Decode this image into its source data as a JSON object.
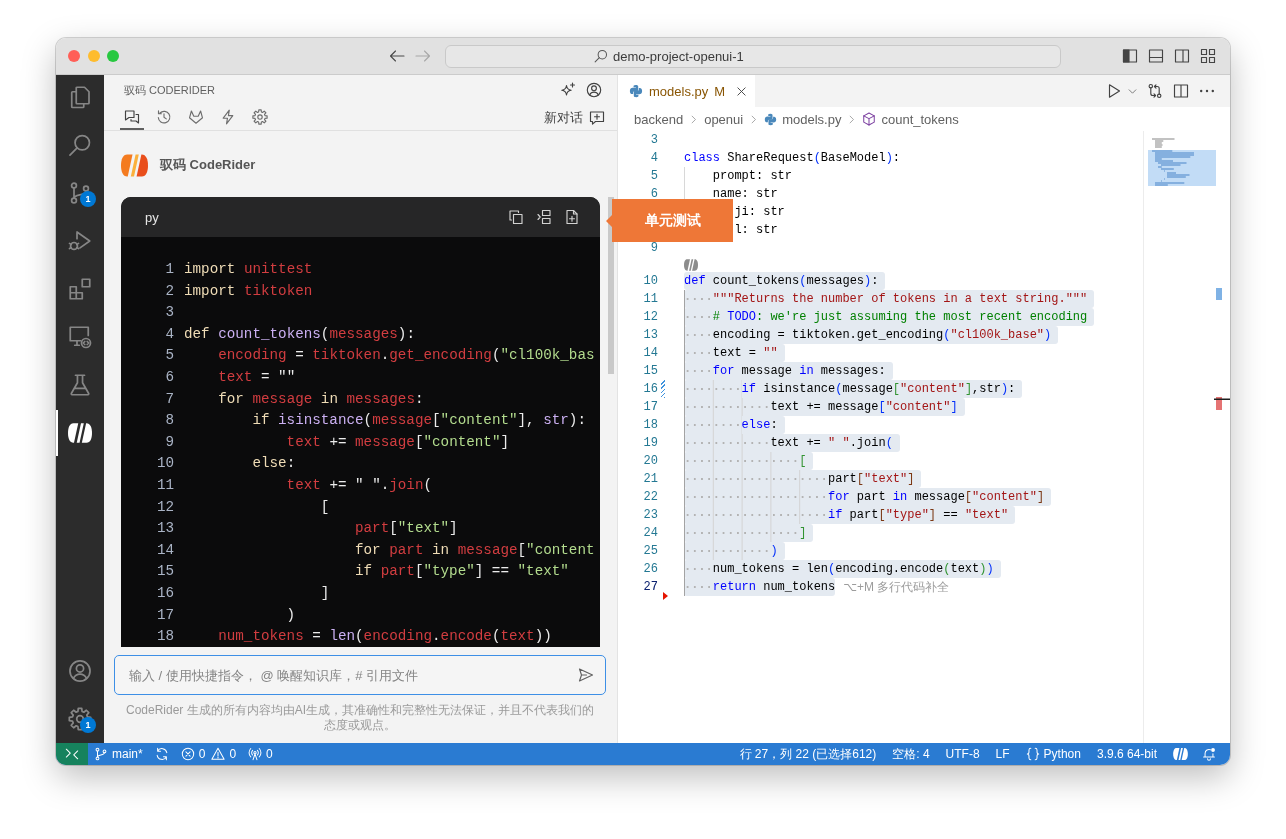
{
  "window": {
    "title": "demo-project-openui-1"
  },
  "activity_bar": {
    "items": [
      {
        "kind": "explorer",
        "selected": false
      },
      {
        "kind": "search",
        "selected": false
      },
      {
        "kind": "scm",
        "selected": false,
        "badge": "1"
      },
      {
        "kind": "debug",
        "selected": false
      },
      {
        "kind": "extensions",
        "selected": false
      },
      {
        "kind": "remote",
        "selected": false
      },
      {
        "kind": "testing",
        "selected": false
      },
      {
        "kind": "coderider",
        "selected": true
      }
    ],
    "bottom": [
      {
        "kind": "account"
      },
      {
        "kind": "manage",
        "badge": "1"
      }
    ]
  },
  "sidebar": {
    "title": "驭码 CODERIDER",
    "tabs": [
      {
        "kind": "chat",
        "selected": true
      },
      {
        "kind": "history",
        "selected": false
      },
      {
        "kind": "fox",
        "selected": false
      },
      {
        "kind": "lightning",
        "selected": false
      },
      {
        "kind": "settings",
        "selected": false
      }
    ],
    "new_chat": "新对话",
    "assistant": "驭码 CodeRider",
    "code_block": {
      "language": "py",
      "lines": [
        {
          "number": "1",
          "tokens": [
            {
              "kind": "keyword",
              "text": "import "
            },
            {
              "kind": "name",
              "text": "unittest"
            }
          ]
        },
        {
          "number": "2",
          "tokens": [
            {
              "kind": "keyword",
              "text": "import "
            },
            {
              "kind": "name",
              "text": "tiktoken"
            }
          ]
        },
        {
          "number": "3"
        },
        {
          "number": "4",
          "tokens": [
            {
              "kind": "keyword",
              "text": "def "
            },
            {
              "kind": "function",
              "text": "count_tokens"
            },
            {
              "kind": "text",
              "text": "("
            },
            {
              "kind": "name",
              "text": "messages"
            },
            {
              "kind": "text",
              "text": "):"
            }
          ],
          "children": [
            {
              "number": "5",
              "tokens": [
                {
                  "kind": "name",
                  "text": "encoding"
                },
                {
                  "kind": "text",
                  "text": " = "
                },
                {
                  "kind": "name",
                  "text": "tiktoken"
                },
                {
                  "kind": "text",
                  "text": "."
                },
                {
                  "kind": "name",
                  "text": "get_encoding"
                },
                {
                  "kind": "text",
                  "text": "("
                },
                {
                  "kind": "string",
                  "text": "\"cl100k_bas"
                }
              ]
            },
            {
              "number": "6",
              "tokens": [
                {
                  "kind": "name",
                  "text": "text"
                },
                {
                  "kind": "text",
                  "text": " = \"\""
                }
              ]
            },
            {
              "number": "7",
              "tokens": [
                {
                  "kind": "keyword",
                  "text": "for "
                },
                {
                  "kind": "name",
                  "text": "message"
                },
                {
                  "kind": "keyword",
                  "text": " in "
                },
                {
                  "kind": "name",
                  "text": "messages"
                },
                {
                  "kind": "text",
                  "text": ":"
                }
              ],
              "children": [
                {
                  "number": "8",
                  "tokens": [
                    {
                      "kind": "keyword",
                      "text": "if "
                    },
                    {
                      "kind": "function",
                      "text": "isinstance"
                    },
                    {
                      "kind": "text",
                      "text": "("
                    },
                    {
                      "kind": "name",
                      "text": "message"
                    },
                    {
                      "kind": "text",
                      "text": "["
                    },
                    {
                      "kind": "string",
                      "text": "\"content\""
                    },
                    {
                      "kind": "text",
                      "text": "], "
                    },
                    {
                      "kind": "function",
                      "text": "str"
                    },
                    {
                      "kind": "text",
                      "text": "):"
                    }
                  ],
                  "children": [
                    {
                      "number": "9",
                      "tokens": [
                        {
                          "kind": "name",
                          "text": "text"
                        },
                        {
                          "kind": "text",
                          "text": " += "
                        },
                        {
                          "kind": "name",
                          "text": "message"
                        },
                        {
                          "kind": "text",
                          "text": "["
                        },
                        {
                          "kind": "string",
                          "text": "\"content\""
                        },
                        {
                          "kind": "text",
                          "text": "]"
                        }
                      ]
                    }
                  ]
                },
                {
                  "number": "10",
                  "tokens": [
                    {
                      "kind": "keyword",
                      "text": "else"
                    },
                    {
                      "kind": "text",
                      "text": ":"
                    }
                  ],
                  "children": [
                    {
                      "number": "11",
                      "tokens": [
                        {
                          "kind": "name",
                          "text": "text"
                        },
                        {
                          "kind": "text",
                          "text": " += \" \"."
                        },
                        {
                          "kind": "name",
                          "text": "join"
                        },
                        {
                          "kind": "text",
                          "text": "("
                        }
                      ],
                      "children": [
                        {
                          "number": "12",
                          "tokens": [
                            {
                              "kind": "text",
                              "text": "["
                            }
                          ],
                          "children": [
                            {
                              "number": "13",
                              "tokens": [
                                {
                                  "kind": "name",
                                  "text": "part"
                                },
                                {
                                  "kind": "text",
                                  "text": "["
                                },
                                {
                                  "kind": "string",
                                  "text": "\"text\""
                                },
                                {
                                  "kind": "text",
                                  "text": "]"
                                }
                              ]
                            },
                            {
                              "number": "14",
                              "tokens": [
                                {
                                  "kind": "keyword",
                                  "text": "for "
                                },
                                {
                                  "kind": "name",
                                  "text": "part"
                                },
                                {
                                  "kind": "keyword",
                                  "text": " in "
                                },
                                {
                                  "kind": "name",
                                  "text": "message"
                                },
                                {
                                  "kind": "text",
                                  "text": "["
                                },
                                {
                                  "kind": "string",
                                  "text": "\"content"
                                }
                              ]
                            },
                            {
                              "number": "15",
                              "tokens": [
                                {
                                  "kind": "keyword",
                                  "text": "if "
                                },
                                {
                                  "kind": "name",
                                  "text": "part"
                                },
                                {
                                  "kind": "text",
                                  "text": "["
                                },
                                {
                                  "kind": "string",
                                  "text": "\"type\""
                                },
                                {
                                  "kind": "text",
                                  "text": "] == "
                                },
                                {
                                  "kind": "string",
                                  "text": "\"text\""
                                }
                              ]
                            }
                          ]
                        },
                        {
                          "number": "16",
                          "tokens": [
                            {
                              "kind": "text",
                              "text": "]"
                            }
                          ]
                        }
                      ]
                    },
                    {
                      "number": "17",
                      "tokens": [
                        {
                          "kind": "text",
                          "text": ")"
                        }
                      ]
                    }
                  ]
                }
              ]
            },
            {
              "number": "18",
              "tokens": [
                {
                  "kind": "name",
                  "text": "num_tokens"
                },
                {
                  "kind": "text",
                  "text": " = "
                },
                {
                  "kind": "function",
                  "text": "len"
                },
                {
                  "kind": "text",
                  "text": "("
                },
                {
                  "kind": "name",
                  "text": "encoding"
                },
                {
                  "kind": "text",
                  "text": "."
                },
                {
                  "kind": "name",
                  "text": "encode"
                },
                {
                  "kind": "text",
                  "text": "("
                },
                {
                  "kind": "name",
                  "text": "text"
                },
                {
                  "kind": "text",
                  "text": "))"
                }
              ]
            }
          ]
        }
      ]
    },
    "tooltip": "单元测试",
    "input": {
      "placeholder": "输入 / 使用快捷指令， @ 唤醒知识库，# 引用文件"
    },
    "disclaimer": "CodeRider 生成的所有内容均由AI生成，其准确性和完整性无法保证，并且不代表我们的态度或观点。"
  },
  "editor": {
    "tabs": [
      {
        "title": "models.py",
        "status": "M",
        "selected": true
      }
    ],
    "breadcrumbs": [
      {
        "kind": "folder",
        "text": "backend"
      },
      {
        "kind": "folder",
        "text": "openui"
      },
      {
        "kind": "file",
        "text": "models.py"
      },
      {
        "kind": "symbol",
        "text": "count_tokens"
      }
    ],
    "lines": [
      {
        "kind": "code",
        "number": "3",
        "selected": false,
        "current": false
      },
      {
        "kind": "code",
        "number": "4",
        "selected": false,
        "current": false,
        "tokens": [
          {
            "kind": "keyword",
            "text": "class"
          },
          {
            "kind": "text",
            "text": " ShareRequest"
          },
          {
            "kind": "bracket1",
            "text": "("
          },
          {
            "kind": "text",
            "text": "BaseModel"
          },
          {
            "kind": "bracket1",
            "text": ")"
          },
          {
            "kind": "text",
            "text": ":"
          }
        ],
        "children": [
          {
            "kind": "code",
            "number": "5",
            "selected": false,
            "current": false,
            "tokens": [
              {
                "kind": "text",
                "text": "prompt: str"
              }
            ]
          },
          {
            "kind": "code",
            "number": "6",
            "selected": false,
            "current": false,
            "tokens": [
              {
                "kind": "text",
                "text": "name: str"
              }
            ]
          },
          {
            "kind": "code",
            "selected": false,
            "tokens": [
              {
                "kind": "text",
                "text": "   ji: str"
              }
            ]
          },
          {
            "kind": "code",
            "selected": false,
            "tokens": [
              {
                "kind": "text",
                "text": "   l: str"
              }
            ]
          }
        ]
      },
      {
        "kind": "code",
        "number": "9",
        "selected": false,
        "current": false
      },
      {
        "kind": "codelens"
      },
      {
        "kind": "code",
        "number": "10",
        "selected": true,
        "current": false,
        "tokens": [
          {
            "kind": "keyword",
            "text": "def"
          },
          {
            "kind": "text",
            "text": " count_tokens"
          },
          {
            "kind": "bracket1",
            "text": "("
          },
          {
            "kind": "text",
            "text": "messages"
          },
          {
            "kind": "bracket1",
            "text": ")"
          },
          {
            "kind": "text",
            "text": ":"
          }
        ],
        "children": [
          {
            "kind": "code",
            "number": "11",
            "selected": true,
            "current": false,
            "tokens": [
              {
                "kind": "string",
                "text": "\"\"\"Returns the number of tokens in a text string.\"\"\""
              }
            ]
          },
          {
            "kind": "code",
            "number": "12",
            "selected": true,
            "current": false,
            "tokens": [
              {
                "kind": "comment",
                "text": "# "
              },
              {
                "kind": "tag",
                "text": "TODO"
              },
              {
                "kind": "comment",
                "text": ": we're just assuming the most recent encoding"
              }
            ]
          },
          {
            "kind": "code",
            "number": "13",
            "selected": true,
            "current": false,
            "tokens": [
              {
                "kind": "text",
                "text": "encoding = tiktoken.get_encoding"
              },
              {
                "kind": "bracket1",
                "text": "("
              },
              {
                "kind": "string",
                "text": "\"cl100k_base\""
              },
              {
                "kind": "bracket1",
                "text": ")"
              }
            ]
          },
          {
            "kind": "code",
            "number": "14",
            "selected": true,
            "current": false,
            "tokens": [
              {
                "kind": "text",
                "text": "text = "
              },
              {
                "kind": "string",
                "text": "\"\""
              }
            ]
          },
          {
            "kind": "code",
            "number": "15",
            "selected": true,
            "current": false,
            "tokens": [
              {
                "kind": "keyword",
                "text": "for"
              },
              {
                "kind": "text",
                "text": " message "
              },
              {
                "kind": "keyword",
                "text": "in"
              },
              {
                "kind": "text",
                "text": " messages:"
              }
            ],
            "children": [
              {
                "kind": "code",
                "number": "16",
                "selected": true,
                "current": false,
                "marker": {
                  "kind": "modified"
                },
                "tokens": [
                  {
                    "kind": "keyword",
                    "text": "if"
                  },
                  {
                    "kind": "text",
                    "text": " isinstance"
                  },
                  {
                    "kind": "bracket1",
                    "text": "("
                  },
                  {
                    "kind": "text",
                    "text": "message"
                  },
                  {
                    "kind": "bracket2",
                    "text": "["
                  },
                  {
                    "kind": "string",
                    "text": "\"content\""
                  },
                  {
                    "kind": "bracket2",
                    "text": "]"
                  },
                  {
                    "kind": "text",
                    "text": ",str"
                  },
                  {
                    "kind": "bracket1",
                    "text": ")"
                  },
                  {
                    "kind": "text",
                    "text": ":"
                  }
                ],
                "children": [
                  {
                    "kind": "code",
                    "number": "17",
                    "selected": true,
                    "current": false,
                    "tokens": [
                      {
                        "kind": "text",
                        "text": "text += message"
                      },
                      {
                        "kind": "bracket1",
                        "text": "["
                      },
                      {
                        "kind": "string",
                        "text": "\"content\""
                      },
                      {
                        "kind": "bracket1",
                        "text": "]"
                      }
                    ]
                  }
                ]
              },
              {
                "kind": "code",
                "number": "18",
                "selected": true,
                "current": false,
                "tokens": [
                  {
                    "kind": "keyword",
                    "text": "else"
                  },
                  {
                    "kind": "text",
                    "text": ":"
                  }
                ],
                "children": [
                  {
                    "kind": "code",
                    "number": "19",
                    "selected": true,
                    "current": false,
                    "tokens": [
                      {
                        "kind": "text",
                        "text": "text += "
                      },
                      {
                        "kind": "string",
                        "text": "\" \""
                      },
                      {
                        "kind": "text",
                        "text": ".join"
                      },
                      {
                        "kind": "bracket1",
                        "text": "("
                      }
                    ],
                    "children": [
                      {
                        "kind": "code",
                        "number": "20",
                        "selected": true,
                        "current": false,
                        "tokens": [
                          {
                            "kind": "bracket2",
                            "text": "["
                          }
                        ],
                        "children": [
                          {
                            "kind": "code",
                            "number": "21",
                            "selected": true,
                            "current": false,
                            "tokens": [
                              {
                                "kind": "text",
                                "text": "part"
                              },
                              {
                                "kind": "bracket3",
                                "text": "["
                              },
                              {
                                "kind": "string",
                                "text": "\"text\""
                              },
                              {
                                "kind": "bracket3",
                                "text": "]"
                              }
                            ]
                          },
                          {
                            "kind": "code",
                            "number": "22",
                            "selected": true,
                            "current": false,
                            "tokens": [
                              {
                                "kind": "keyword",
                                "text": "for"
                              },
                              {
                                "kind": "text",
                                "text": " part "
                              },
                              {
                                "kind": "keyword",
                                "text": "in"
                              },
                              {
                                "kind": "text",
                                "text": " message"
                              },
                              {
                                "kind": "bracket3",
                                "text": "["
                              },
                              {
                                "kind": "string",
                                "text": "\"content\""
                              },
                              {
                                "kind": "bracket3",
                                "text": "]"
                              }
                            ]
                          },
                          {
                            "kind": "code",
                            "number": "23",
                            "selected": true,
                            "current": false,
                            "tokens": [
                              {
                                "kind": "keyword",
                                "text": "if"
                              },
                              {
                                "kind": "text",
                                "text": " part"
                              },
                              {
                                "kind": "bracket3",
                                "text": "["
                              },
                              {
                                "kind": "string",
                                "text": "\"type\""
                              },
                              {
                                "kind": "bracket3",
                                "text": "]"
                              },
                              {
                                "kind": "text",
                                "text": " == "
                              },
                              {
                                "kind": "string",
                                "text": "\"text\""
                              }
                            ]
                          }
                        ]
                      },
                      {
                        "kind": "code",
                        "number": "24",
                        "selected": true,
                        "current": false,
                        "tokens": [
                          {
                            "kind": "bracket2",
                            "text": "]"
                          }
                        ]
                      }
                    ]
                  },
                  {
                    "kind": "code",
                    "number": "25",
                    "selected": true,
                    "current": false,
                    "tokens": [
                      {
                        "kind": "bracket1",
                        "text": ")"
                      }
                    ]
                  }
                ]
              }
            ]
          },
          {
            "kind": "code",
            "number": "26",
            "selected": true,
            "current": false,
            "tokens": [
              {
                "kind": "text",
                "text": "num_tokens = len"
              },
              {
                "kind": "bracket1",
                "text": "("
              },
              {
                "kind": "text",
                "text": "encoding.encode"
              },
              {
                "kind": "bracket2",
                "text": "("
              },
              {
                "kind": "text",
                "text": "text"
              },
              {
                "kind": "bracket2",
                "text": ")"
              },
              {
                "kind": "bracket1",
                "text": ")"
              }
            ]
          },
          {
            "kind": "code",
            "number": "27",
            "selected": true,
            "current": true,
            "marker": {
              "kind": "deleted"
            },
            "hint": "⌥+M 多行代码补全",
            "tokens": [
              {
                "kind": "keyword",
                "text": "return"
              },
              {
                "kind": "text",
                "text": " num_tokens"
              }
            ]
          }
        ]
      }
    ]
  },
  "status_bar": {
    "branch": "main*",
    "errors": "0",
    "warnings": "0",
    "ports": "0",
    "position": "行 27，列 22 (已选择612)",
    "indentation": "空格: 4",
    "encoding": "UTF-8",
    "line_ending": "LF",
    "language": "Python",
    "interpreter": "3.9.6 64-bit"
  }
}
